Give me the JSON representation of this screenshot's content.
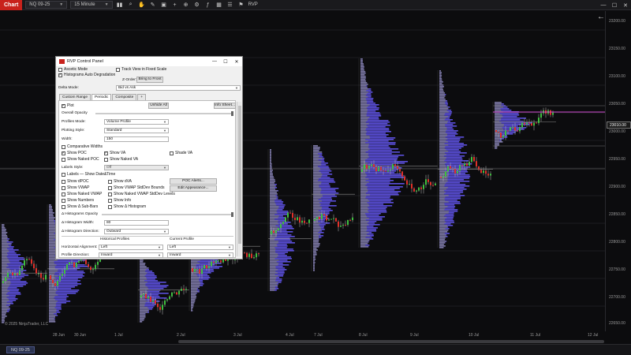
{
  "toolbar": {
    "chart_label": "Chart",
    "instrument": "NQ 09-25",
    "interval": "15 Minute",
    "indicator_label": "RVP"
  },
  "price_axis": {
    "labels": [
      "23200.00",
      "23150.00",
      "23100.00",
      "23050.00",
      "23000.00",
      "22950.00",
      "22900.00",
      "22850.00",
      "22800.00",
      "22750.00",
      "22700.00",
      "22650.00"
    ],
    "current_price": "23010.00",
    "corner_label": "F"
  },
  "time_axis": {
    "labels": [
      "28 Jun",
      "30 Jun",
      "1 Jul",
      "2 Jul",
      "3 Jul",
      "4 Jul",
      "7 Jul",
      "8 Jul",
      "9 Jul",
      "10 Jul",
      "11 Jul",
      "12 Jul"
    ]
  },
  "copyright": "© 2025 NinjaTrader, LLC",
  "status_tab": "NQ 09-25",
  "panel": {
    "title": "RVP Control Panel",
    "ascetic_mode": "Ascetic Mode",
    "track_view": "Track View in Fixed Scale",
    "auto_degradation": "Histograms Auto Degradation",
    "z_order": "Z-Order:",
    "bring_to_front": "Bring to Front",
    "delta_mode_label": "Delta Mode:",
    "delta_mode_value": "Bid vs Ask",
    "tabs": [
      "Custom Range",
      "Periodic",
      "Composite",
      "+"
    ],
    "plot": "Plot",
    "unhide_all": "Unhide All",
    "info_sheet": "Info Sheet...",
    "overall_opacity": "Overall Opacity",
    "profiles_mode_label": "Profiles Mode:",
    "profiles_mode_value": "Volume Profile",
    "plotting_style_label": "Plotting Style:",
    "plotting_style_value": "Standard",
    "width_label": "Width:",
    "width_value": "150",
    "comparative_widths": "Comparative Widths",
    "show_poc": "Show POC",
    "show_va": "Show VA",
    "shade_va": "Shade VA",
    "show_naked_poc": "Show Naked POC",
    "show_naked_va": "Show Naked VA",
    "labels_style_label": "Labels Style:",
    "labels_style_value": "Off",
    "labels_show_datetime": "Labels — Show Date&Time",
    "show_dpoc": "Show dPOC",
    "show_dva": "Show dVA",
    "poc_alerts": "POC Alerts...",
    "show_vwap": "Show VWAP",
    "show_vwap_stddev": "Show VWAP StdDev Bounds",
    "edit_appearance": "Edit Appearance...",
    "show_naked_vwap": "Show Naked VWAP",
    "show_naked_vwap_stddev": "Show Naked VWAP StdDev Levels",
    "show_numbers": "Show Numbers",
    "show_info": "Show Info",
    "show_delta_subbars": "Show Δ Sub-Bars",
    "show_delta_histogram": "Show Δ Histogram",
    "delta_hist_opacity": "Δ Histograms Opacity",
    "delta_hist_width_label": "Δ Histogram Width:",
    "delta_hist_width_value": "80",
    "delta_hist_dir_label": "Δ Histogram Direction:",
    "delta_hist_dir_value": "Outward",
    "historical_profiles": "Historical Profiles",
    "current_profile": "Current Profile",
    "horizontal_alignment_label": "Horizontal Alignment:",
    "horizontal_alignment_hist": "Left",
    "horizontal_alignment_curr": "Left",
    "profile_direction_label": "Profile Direction:",
    "profile_direction_hist": "Inward",
    "profile_direction_curr": "Inward",
    "checked": {
      "plot": true,
      "auto_degradation": true,
      "show_poc": true,
      "show_va": true
    }
  },
  "colors": {
    "chart_bg": "#0c0c0e",
    "up_candle": "#3fbf3f",
    "down_candle": "#e0302a",
    "volume_profile": "#6a5cff",
    "poc_line": "#d14bd1",
    "brand_red": "#c8221c"
  }
}
